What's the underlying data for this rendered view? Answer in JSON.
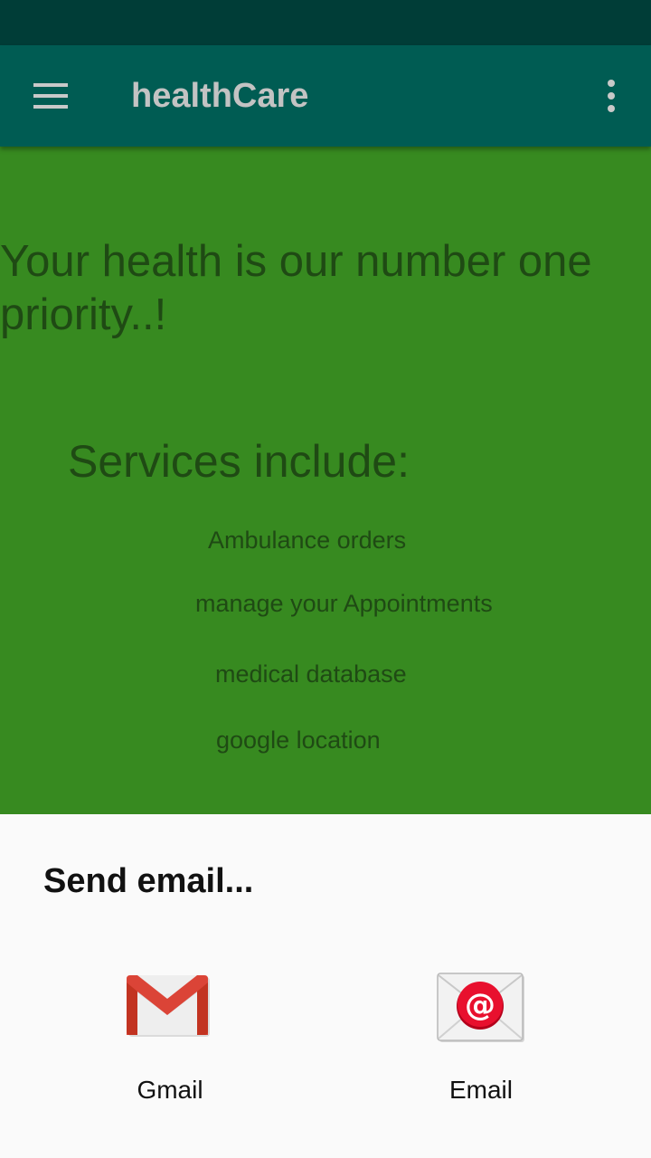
{
  "app_bar": {
    "title": "healthCare",
    "menu_icon": "hamburger-menu-icon",
    "overflow_icon": "more-vert-icon",
    "color": "#005c53"
  },
  "status_bar": {
    "color": "#003d37"
  },
  "content": {
    "background": "#378a20",
    "headline": "Your health is our number one priority..!",
    "services_title": "Services include:",
    "services": [
      "Ambulance orders",
      "manage your Appointments",
      "medical database",
      "google location"
    ]
  },
  "share_sheet": {
    "title": "Send email...",
    "targets": [
      {
        "label": "Gmail",
        "icon": "gmail-icon"
      },
      {
        "label": "Email",
        "icon": "email-app-icon"
      }
    ]
  }
}
